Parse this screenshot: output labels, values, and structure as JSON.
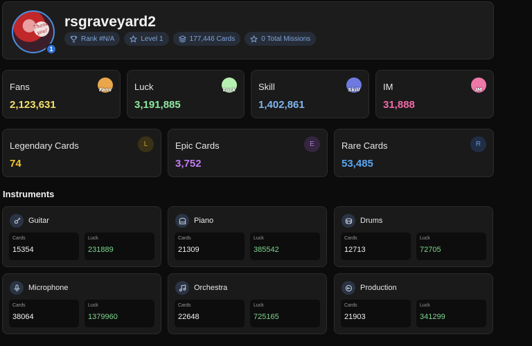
{
  "profile": {
    "username": "rsgraveyard2",
    "level_badge": "1",
    "avatar_sign": "Thank you!",
    "chips": [
      {
        "icon": "trophy-icon",
        "label": "Rank #N/A"
      },
      {
        "icon": "star-icon",
        "label": "Level 1"
      },
      {
        "icon": "layers-icon",
        "label": "177,446 Cards"
      },
      {
        "icon": "star-icon",
        "label": "0 Total Missions"
      }
    ]
  },
  "stats": [
    {
      "title": "Fans",
      "value": "2,123,631",
      "icon_text": "Fans",
      "color": "#f4e06b",
      "icon_color": "#e9a64a"
    },
    {
      "title": "Luck",
      "value": "3,191,885",
      "icon_text": "Luck",
      "color": "#8ee8a0",
      "icon_color": "#b6f0b0"
    },
    {
      "title": "Skill",
      "value": "1,402,861",
      "icon_text": "Skill",
      "color": "#7fb4ee",
      "icon_color": "#6e7ae0"
    },
    {
      "title": "IM",
      "value": "31,888",
      "icon_text": "IM",
      "color": "#f06aa8",
      "icon_color": "#ee78a8"
    }
  ],
  "rarities": [
    {
      "title": "Legendary Cards",
      "value": "74",
      "letter": "L",
      "color": "#f2c22e",
      "icon_bg": "#3a3216",
      "icon_fg": "#c9a02c"
    },
    {
      "title": "Epic Cards",
      "value": "3,752",
      "letter": "E",
      "color": "#c27cf0",
      "icon_bg": "#35253f",
      "icon_fg": "#a57fc9"
    },
    {
      "title": "Rare Cards",
      "value": "53,485",
      "letter": "R",
      "color": "#5aa7f0",
      "icon_bg": "#1f2e45",
      "icon_fg": "#6a98d0"
    }
  ],
  "instruments_title": "Instruments",
  "instrument_labels": {
    "cards": "Cards",
    "luck": "Luck"
  },
  "instruments": [
    {
      "name": "Guitar",
      "icon": "guitar-icon",
      "cards": "15354",
      "luck": "231889"
    },
    {
      "name": "Piano",
      "icon": "piano-icon",
      "cards": "21309",
      "luck": "385542"
    },
    {
      "name": "Drums",
      "icon": "drum-icon",
      "cards": "12713",
      "luck": "72705"
    },
    {
      "name": "Microphone",
      "icon": "microphone-icon",
      "cards": "38064",
      "luck": "1379960"
    },
    {
      "name": "Orchestra",
      "icon": "music-note-icon",
      "cards": "22648",
      "luck": "725165"
    },
    {
      "name": "Production",
      "icon": "disc-icon",
      "cards": "21903",
      "luck": "341299"
    }
  ]
}
